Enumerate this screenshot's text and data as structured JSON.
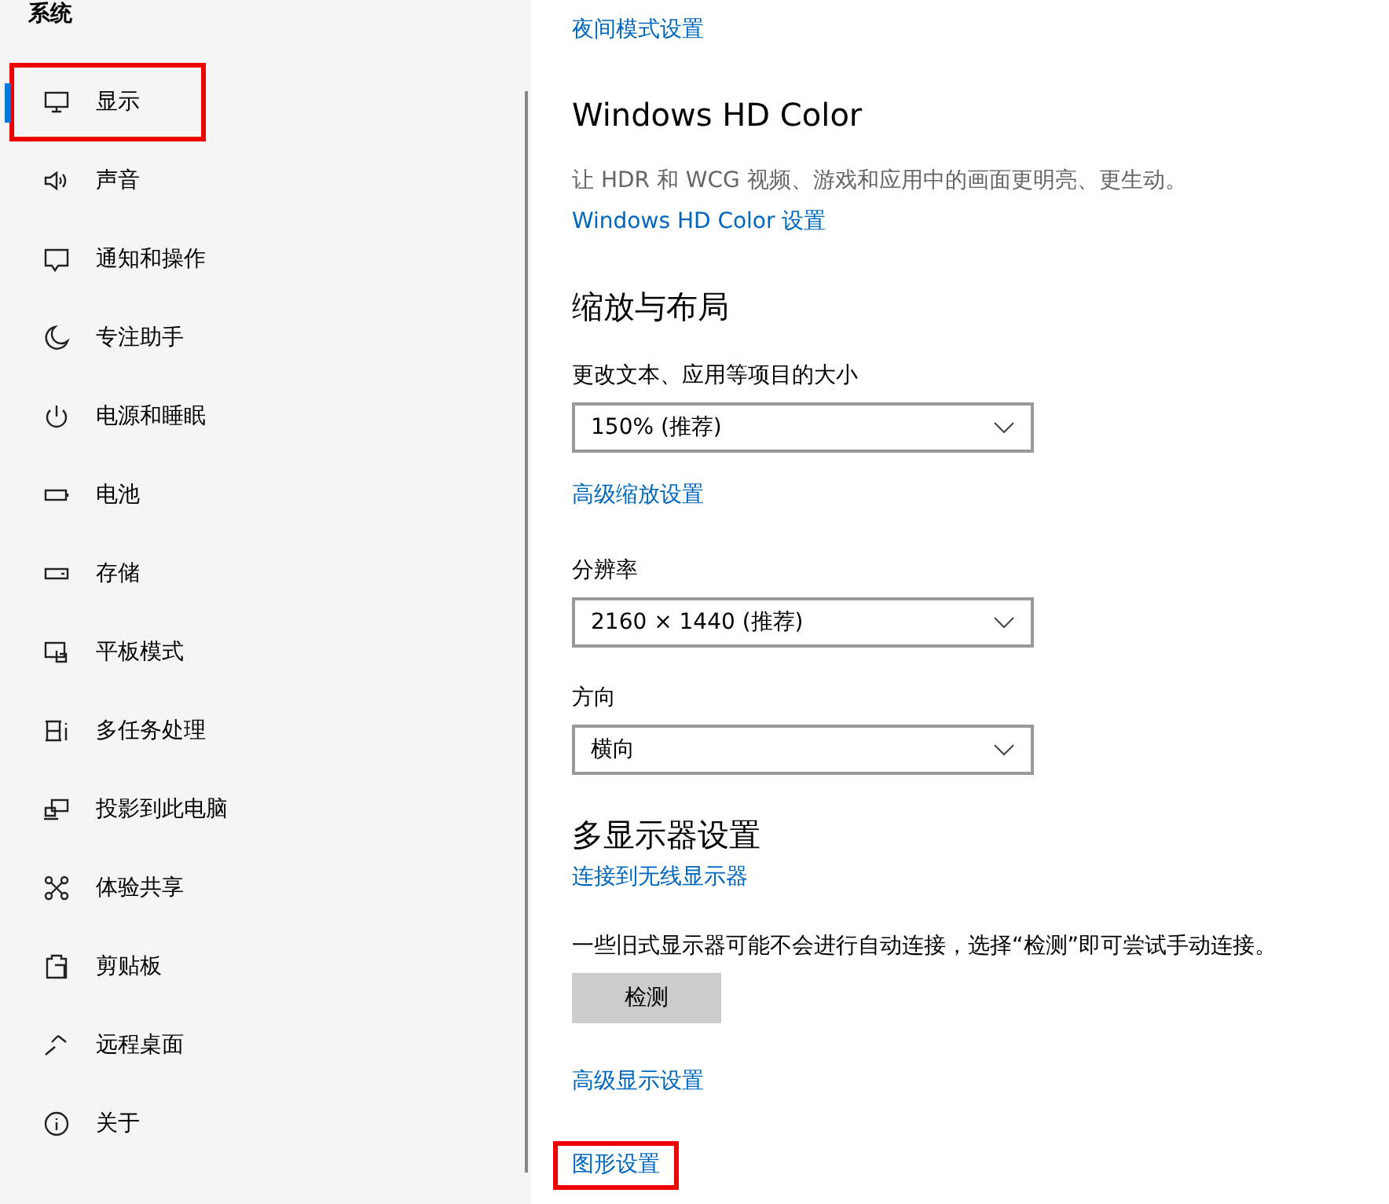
{
  "sidebar": {
    "title": "系统",
    "items": [
      {
        "label": "显示",
        "selected": true,
        "highlighted": true
      },
      {
        "label": "声音",
        "selected": false,
        "highlighted": false
      },
      {
        "label": "通知和操作",
        "selected": false,
        "highlighted": false
      },
      {
        "label": "专注助手",
        "selected": false,
        "highlighted": false
      },
      {
        "label": "电源和睡眠",
        "selected": false,
        "highlighted": false
      },
      {
        "label": "电池",
        "selected": false,
        "highlighted": false
      },
      {
        "label": "存储",
        "selected": false,
        "highlighted": false
      },
      {
        "label": "平板模式",
        "selected": false,
        "highlighted": false
      },
      {
        "label": "多任务处理",
        "selected": false,
        "highlighted": false
      },
      {
        "label": "投影到此电脑",
        "selected": false,
        "highlighted": false
      },
      {
        "label": "体验共享",
        "selected": false,
        "highlighted": false
      },
      {
        "label": "剪贴板",
        "selected": false,
        "highlighted": false
      },
      {
        "label": "远程桌面",
        "selected": false,
        "highlighted": false
      },
      {
        "label": "关于",
        "selected": false,
        "highlighted": false
      }
    ]
  },
  "content": [
    {
      "kind": "link",
      "text": "夜间模式设置",
      "highlighted": false
    },
    {
      "kind": "heading",
      "text": "Windows HD Color"
    },
    {
      "kind": "description",
      "text": "让 HDR 和 WCG 视频、游戏和应用中的画面更明亮、更生动。"
    },
    {
      "kind": "link",
      "text": "Windows HD Color 设置",
      "highlighted": false
    },
    {
      "kind": "heading",
      "text": "缩放与布局"
    },
    {
      "kind": "label",
      "text": "更改文本、应用等项目的大小"
    },
    {
      "kind": "dropdown",
      "value": "150% (推荐)"
    },
    {
      "kind": "link",
      "text": "高级缩放设置",
      "highlighted": false
    },
    {
      "kind": "label",
      "text": "分辨率"
    },
    {
      "kind": "dropdown",
      "value": "2160 × 1440 (推荐)"
    },
    {
      "kind": "label",
      "text": "方向"
    },
    {
      "kind": "dropdown",
      "value": "横向"
    },
    {
      "kind": "heading",
      "text": "多显示器设置"
    },
    {
      "kind": "link",
      "text": "连接到无线显示器",
      "highlighted": false
    },
    {
      "kind": "text",
      "text": "一些旧式显示器可能不会进行自动连接，选择“检测”即可尝试手动连接。"
    },
    {
      "kind": "button",
      "text": "检测"
    },
    {
      "kind": "link",
      "text": "高级显示设置",
      "highlighted": false
    },
    {
      "kind": "link",
      "text": "图形设置",
      "highlighted": true
    }
  ]
}
